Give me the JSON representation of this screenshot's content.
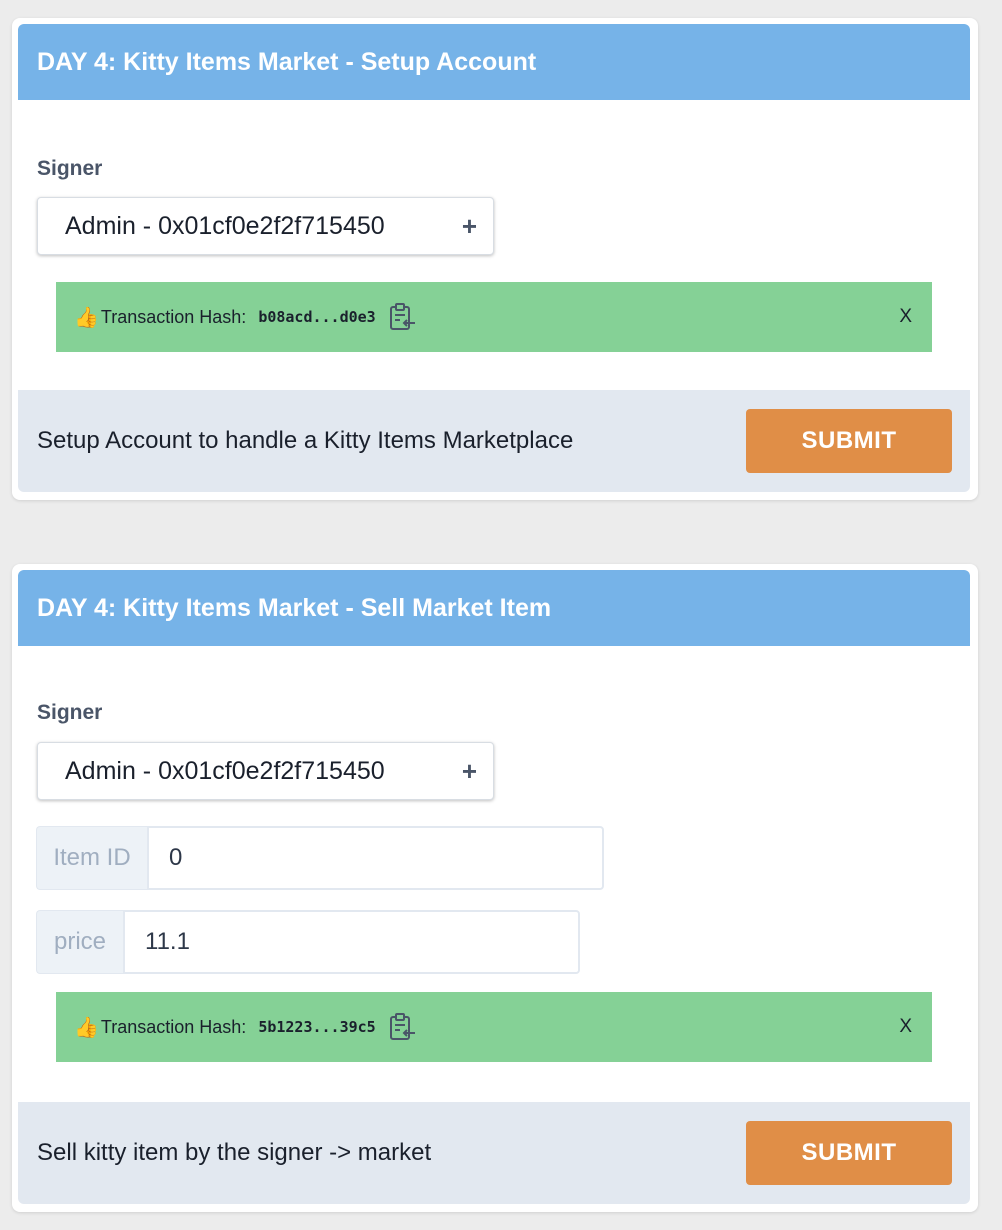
{
  "cards": [
    {
      "title": "DAY 4: Kitty Items Market - Setup Account",
      "signer_label": "Signer",
      "signer_value": "Admin - 0x01cf0e2f2f715450",
      "tx_label": "Transaction Hash:",
      "tx_hash": "b08acd...d0e3",
      "close_label": "X",
      "description": "Setup Account to handle a Kitty Items Marketplace",
      "submit_label": "SUBMIT"
    },
    {
      "title": "DAY 4: Kitty Items Market - Sell Market Item",
      "signer_label": "Signer",
      "signer_value": "Admin - 0x01cf0e2f2f715450",
      "fields": [
        {
          "label": "Item ID",
          "value": "0"
        },
        {
          "label": "price",
          "value": "11.1"
        }
      ],
      "tx_label": "Transaction Hash:",
      "tx_hash": "5b1223...39c5",
      "close_label": "X",
      "description": "Sell kitty item by the signer -> market",
      "submit_label": "SUBMIT"
    }
  ],
  "colors": {
    "header": "#76b3e8",
    "success": "#85d196",
    "submit": "#e08e47",
    "footer": "#e2e8f0"
  },
  "icons": {
    "plus": "+",
    "thumb": "👍"
  }
}
